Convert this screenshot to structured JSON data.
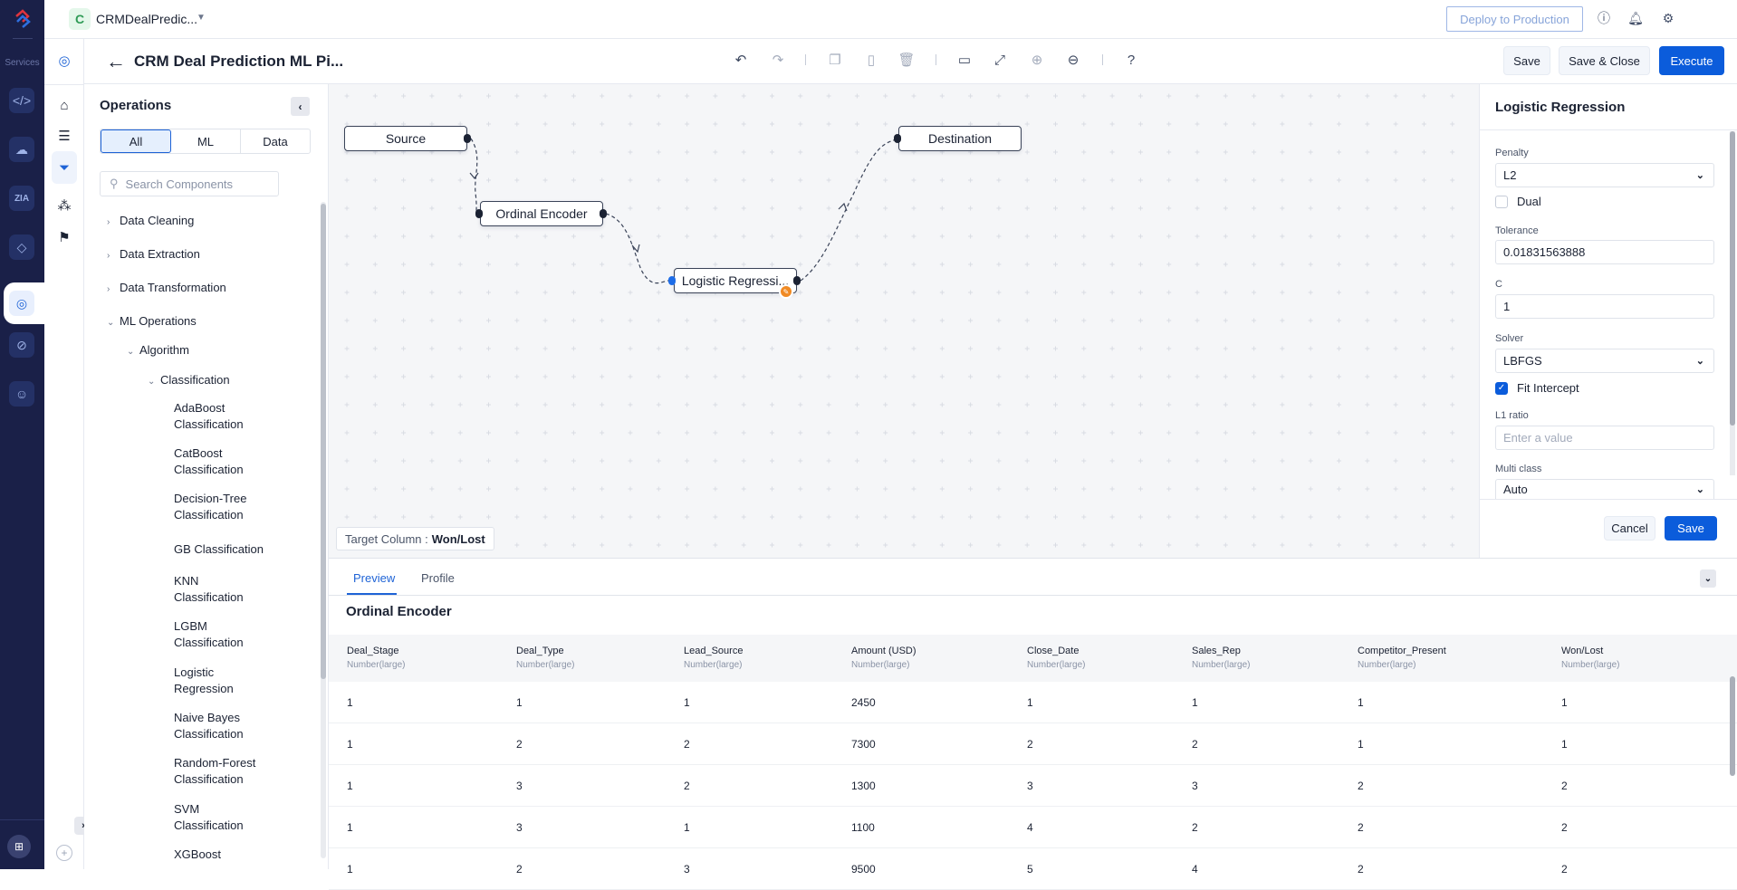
{
  "rail": {
    "services_label": "Services",
    "items": [
      "code-icon",
      "cloud-icon",
      "zia-icon",
      "integration-icon",
      "ml-studio-icon",
      "orbit-icon",
      "bot-icon"
    ],
    "active_item": "ml-studio-icon"
  },
  "topbar": {
    "project_initial": "C",
    "project_name": "CRMDealPredic...",
    "deploy_label": "Deploy to Production",
    "icons": [
      "help-icon",
      "bell-icon",
      "gear-icon",
      "avatar"
    ]
  },
  "header": {
    "title": "CRM Deal Prediction ML Pi...",
    "toolbar": [
      "undo",
      "redo",
      "copy",
      "paste",
      "delete",
      "panel",
      "fit-screen",
      "zoom-in",
      "zoom-out",
      "help"
    ],
    "save_label": "Save",
    "save_close_label": "Save & Close",
    "execute_label": "Execute"
  },
  "operations": {
    "title": "Operations",
    "filters": [
      "All",
      "ML",
      "Data"
    ],
    "active_filter": "All",
    "search_placeholder": "Search Components",
    "groups": [
      {
        "label": "Data Cleaning",
        "expanded": false
      },
      {
        "label": "Data Extraction",
        "expanded": false
      },
      {
        "label": "Data Transformation",
        "expanded": false
      },
      {
        "label": "ML Operations",
        "expanded": true
      }
    ],
    "subgroup": "Algorithm",
    "subsubgroup": "Classification",
    "leaves": [
      [
        "AdaBoost",
        "Classification"
      ],
      [
        "CatBoost",
        "Classification"
      ],
      [
        "Decision-Tree",
        "Classification"
      ],
      [
        "GB Classification"
      ],
      [
        "KNN",
        "Classification"
      ],
      [
        "LGBM",
        "Classification"
      ],
      [
        "Logistic",
        "Regression"
      ],
      [
        "Naive Bayes",
        "Classification"
      ],
      [
        "Random-Forest",
        "Classification"
      ],
      [
        "SVM",
        "Classification"
      ],
      [
        "XGBoost"
      ]
    ]
  },
  "canvas": {
    "nodes": [
      {
        "id": "source",
        "label": "Source"
      },
      {
        "id": "ordinal",
        "label": "Ordinal Encoder"
      },
      {
        "id": "logistic",
        "label": "Logistic Regressi..."
      },
      {
        "id": "destination",
        "label": "Destination"
      }
    ],
    "edges": [
      [
        "source",
        "ordinal"
      ],
      [
        "ordinal",
        "logistic"
      ],
      [
        "logistic",
        "destination"
      ]
    ],
    "target_label": "Target Column :",
    "target_value": "Won/Lost"
  },
  "properties": {
    "title": "Logistic Regression",
    "penalty_label": "Penalty",
    "penalty_value": "L2",
    "dual_label": "Dual",
    "dual_checked": false,
    "tolerance_label": "Tolerance",
    "tolerance_value": "0.01831563888",
    "c_label": "C",
    "c_value": "1",
    "solver_label": "Solver",
    "solver_value": "LBFGS",
    "fit_intercept_label": "Fit Intercept",
    "fit_intercept_checked": true,
    "l1_label": "L1 ratio",
    "l1_placeholder": "Enter a value",
    "multiclass_label": "Multi class",
    "multiclass_value": "Auto",
    "cancel_label": "Cancel",
    "save_label": "Save"
  },
  "bottom": {
    "tabs": [
      "Preview",
      "Profile"
    ],
    "active_tab": "Preview",
    "title": "Ordinal Encoder",
    "columns": [
      {
        "name": "Deal_Stage",
        "type": "Number(large)"
      },
      {
        "name": "Deal_Type",
        "type": "Number(large)"
      },
      {
        "name": "Lead_Source",
        "type": "Number(large)"
      },
      {
        "name": "Amount (USD)",
        "type": "Number(large)"
      },
      {
        "name": "Close_Date",
        "type": "Number(large)"
      },
      {
        "name": "Sales_Rep",
        "type": "Number(large)"
      },
      {
        "name": "Competitor_Present",
        "type": "Number(large)"
      },
      {
        "name": "Won/Lost",
        "type": "Number(large)"
      }
    ],
    "rows": [
      [
        "1",
        "1",
        "1",
        "2450",
        "1",
        "1",
        "1",
        "1"
      ],
      [
        "1",
        "2",
        "2",
        "7300",
        "2",
        "2",
        "1",
        "1"
      ],
      [
        "1",
        "3",
        "2",
        "1300",
        "3",
        "3",
        "2",
        "2"
      ],
      [
        "1",
        "3",
        "1",
        "1100",
        "4",
        "2",
        "2",
        "2"
      ],
      [
        "1",
        "2",
        "3",
        "9500",
        "5",
        "4",
        "2",
        "2"
      ]
    ]
  }
}
